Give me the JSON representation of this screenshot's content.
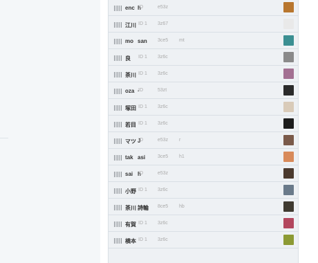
{
  "rows": [
    {
      "name": "enc",
      "sep": "h",
      "id": "ID",
      "code": "e53z",
      "extra": "",
      "avatar": "#b8762e"
    },
    {
      "name": "江川",
      "sep": "",
      "id": "ID 1",
      "code": "3z67",
      "extra": "",
      "avatar": "#e9e9e9"
    },
    {
      "name": "mo",
      "sep": "san",
      "id": "",
      "code": "3ce5",
      "extra": "mt",
      "avatar": "#3b8f92"
    },
    {
      "name": "良",
      "sep": "",
      "id": "ID 1",
      "code": "3z6c",
      "extra": "",
      "avatar": "#8a8a8a"
    },
    {
      "name": "茶川",
      "sep": "",
      "id": "ID 1",
      "code": "3z6c",
      "extra": "",
      "avatar": "#a37092"
    },
    {
      "name": "oza",
      "sep": "·",
      "id": "ID",
      "code": "53zt",
      "extra": "",
      "avatar": "#2b2b2b"
    },
    {
      "name": "塚田",
      "sep": "",
      "id": "ID 1",
      "code": "3z6c",
      "extra": "",
      "avatar": "#d9cbb9"
    },
    {
      "name": "若目",
      "sep": "",
      "id": "ID 1",
      "code": "3z6c",
      "extra": "",
      "avatar": "#1c1c1c"
    },
    {
      "name": "マツ",
      "sep": "J",
      "id": "ID",
      "code": "e53z",
      "extra": "r",
      "avatar": "#7a5a4a"
    },
    {
      "name": "tak",
      "sep": "asi",
      "id": "",
      "code": "3ce5",
      "extra": "h1",
      "avatar": "#d88a5a"
    },
    {
      "name": "sai",
      "sep": "h",
      "id": "ID",
      "code": "e53z",
      "extra": "",
      "avatar": "#4b3a2e"
    },
    {
      "name": "小野",
      "sep": "",
      "id": "ID 1",
      "code": "3z6c",
      "extra": "",
      "avatar": "#6a7a8a"
    },
    {
      "name": "茶川",
      "sep": "詩輪",
      "id": "",
      "code": "8ce5",
      "extra": "hb",
      "avatar": "#3f3a30"
    },
    {
      "name": "有賀",
      "sep": "",
      "id": "ID 1",
      "code": "3z6c",
      "extra": "",
      "avatar": "#b3475e"
    },
    {
      "name": "横本",
      "sep": "",
      "id": "ID 1",
      "code": "3z6c",
      "extra": "",
      "avatar": "#8c9a34"
    }
  ]
}
